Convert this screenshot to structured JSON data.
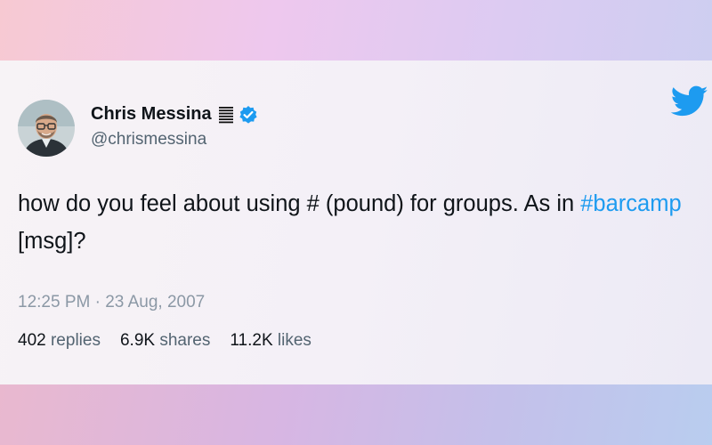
{
  "tweet": {
    "author_name": "Chris Messina",
    "handle": "@chrismessina",
    "text_before": "how do you feel about using # (pound) for groups. As in ",
    "hashtag": "#barcamp",
    "text_after": " [msg]?",
    "timestamp": "12:25 PM · 23 Aug, 2007",
    "stats": [
      {
        "count": "402",
        "label": "replies"
      },
      {
        "count": "6.9K",
        "label": "shares"
      },
      {
        "count": "11.2K",
        "label": "likes"
      }
    ]
  },
  "icons": {
    "name_emoji": "hashtag-lines-icon",
    "verified": "verified-badge-icon",
    "brand": "twitter-bird-icon"
  },
  "colors": {
    "accent": "#1d9bf0",
    "text": "#0f1419",
    "muted": "#536471"
  }
}
